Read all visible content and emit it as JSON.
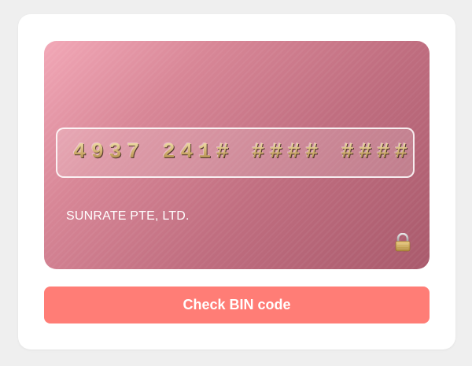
{
  "card": {
    "number": "4937 241# #### ####",
    "holder": "SUNRATE PTE, LTD.",
    "icon": "lock-icon"
  },
  "actions": {
    "check_label": "Check BIN code"
  },
  "colors": {
    "button": "#ff7d76",
    "card_gradient_start": "#f2a8b7",
    "card_gradient_end": "#a95a6c",
    "digits": "#c9a765"
  }
}
